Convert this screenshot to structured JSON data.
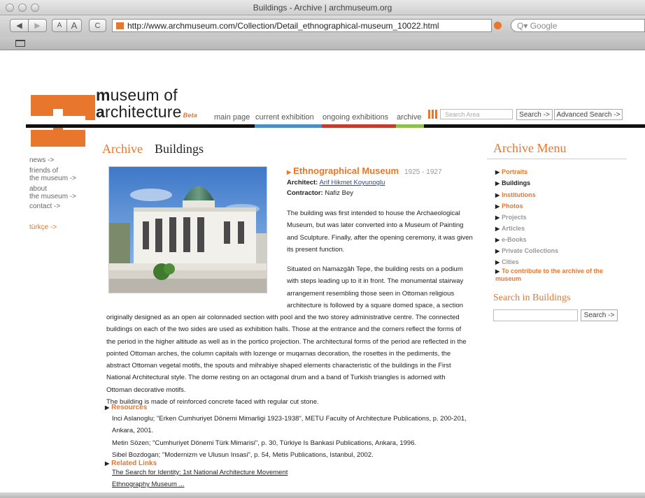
{
  "browser": {
    "window_title": "Buildings - Archive | archmuseum.org",
    "url": "http://www.archmuseum.com/Collection/Detail_ethnographical-museum_10022.html",
    "back_label": "◀",
    "forward_label": "▶",
    "text_smaller_label": "A",
    "text_larger_label": "A",
    "reload_label": "C",
    "google_placeholder": "Q▾ Google",
    "bookmarks_icon": "book-icon"
  },
  "site": {
    "brand_m": "m",
    "brand_line1": "useum of",
    "brand_a": "a",
    "brand_line2": "rchitecture",
    "beta": "Beta",
    "accent": "#e8762d",
    "nav": [
      {
        "label": "main page",
        "color": "#111111"
      },
      {
        "label": "current exhibition",
        "color": "#4a90c8"
      },
      {
        "label": "ongoing exhibitions",
        "color": "#c73a2e"
      },
      {
        "label": "archive",
        "color": "#8fc04a"
      },
      {
        "label": "",
        "color": "#f2c330"
      }
    ],
    "search_placeholder": "Search Area",
    "search_button": "Search ->",
    "advanced_button": "Advanced Search ->"
  },
  "left_nav": {
    "news": "news ->",
    "friends_1": "friends of",
    "friends_2": "the museum ->",
    "about_1": "about",
    "about_2": "the museum ->",
    "contact": "contact ->",
    "turkce": "türkçe ->"
  },
  "breadcrumb": {
    "archive": "Archive",
    "buildings": "Buildings"
  },
  "building": {
    "title": "Ethnographical Museum",
    "years": "1925 - 1927",
    "architect_label": "Architect:",
    "architect": "Arif Hikmet Koyunoglu",
    "contractor_label": "Contractor:",
    "contractor": "Nafiz Bey",
    "para1": [
      "The building was first intended to house the Archaeological",
      "Museum, but was later converted into a Museum of Painting",
      "and Sculpture. Finally, after the opening ceremony, it was given",
      "its present function."
    ],
    "para2_narrow": [
      "Situated on Namazgâh Tepe, the building rests on a podium",
      "with steps leading up to it in front. The monumental stairway",
      "arrangement resembling those seen in Ottoman religious",
      "architecture is followed by a square domed space, a section"
    ],
    "para2_wide": [
      "originally designed as an open air colonnaded section with pool and the two storey administrative centre. The connected",
      "buildings on each of the two sides are used as exhibition halls. Those at the entrance and the corners reflect the forms of",
      "the period in the higher altitude as well as in the portico projection. The architectural forms of the period are reflected in the",
      "pointed Ottoman arches, the column capitals with lozenge or muqarnas decoration, the rosettes in the pediments, the",
      "abstract Ottoman vegetal motifs, the spouts and mihrabiye shaped elements characteristic of the buildings in the First",
      "National Architectural style. The dome resting on an octagonal drum and a band of Turkish triangles is adorned with",
      "Ottoman decorative motifs."
    ],
    "para3": "The building is made of reinforced concrete faced with regular cut stone.",
    "resources_label": "Resources",
    "resources": [
      "Inci Aslanoglu; \"Erken Cumhuriyet Dönemi Mimarligi 1923-1938\", METU Faculty of Architecture Publications, p. 200-201,",
      "Ankara, 2001.",
      "Metin Sözen; \"Cumhuriyet Dönemi Türk Mimarisi\", p. 30, Türkiye Is Bankasi Publications, Ankara, 1996.",
      "Sibel Bozdogan; \"Modernizm ve Ulusun Insasi\", p. 54, Metis Publications, Istanbul, 2002."
    ],
    "related_label": "Related Links",
    "related": [
      "The Search for Identity: 1st National Architecture Movement",
      "Ethnography Museum ..."
    ]
  },
  "archive_menu": {
    "title": "Archive Menu",
    "items": [
      {
        "label": "Portraits",
        "color": "#e8762d"
      },
      {
        "label": "Buildings",
        "color": "#222222"
      },
      {
        "label": "Institutions",
        "color": "#e8762d"
      },
      {
        "label": "Photos",
        "color": "#e8762d"
      },
      {
        "label": "Projects",
        "color": "#999999"
      },
      {
        "label": "Articles",
        "color": "#999999"
      },
      {
        "label": "e-Books",
        "color": "#999999"
      },
      {
        "label": "Private Collections",
        "color": "#999999"
      },
      {
        "label": "Cities",
        "color": "#999999"
      },
      {
        "label": "To contribute to the archive of the museum",
        "color": "#e8762d"
      }
    ],
    "search_title": "Search in Buildings",
    "search_button": "Search ->"
  }
}
